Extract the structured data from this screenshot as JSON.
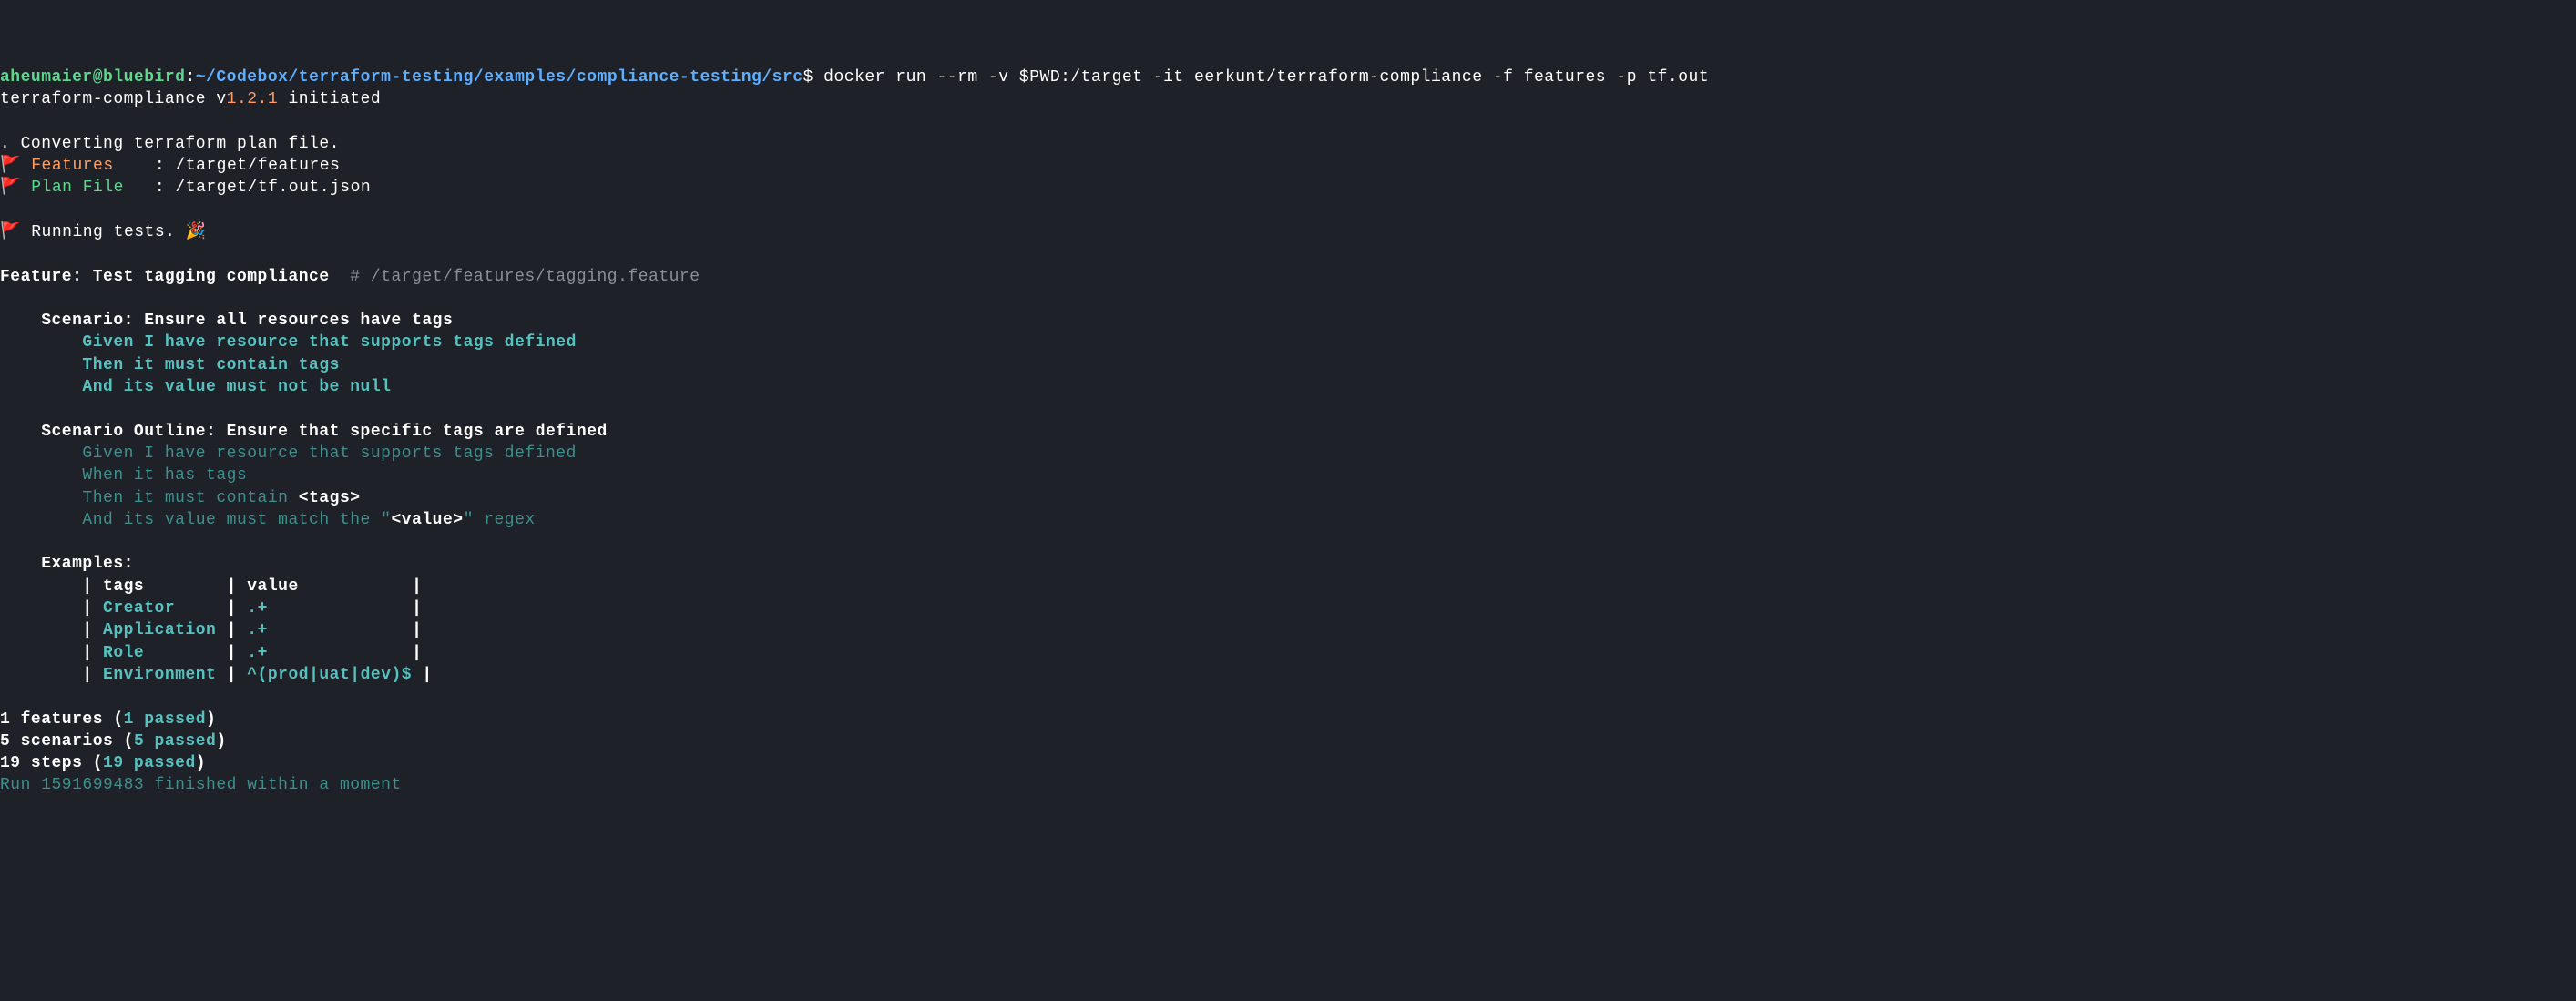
{
  "prompt": {
    "user": "aheumaier@bluebird",
    "sep": ":",
    "path": "~/Codebox/terraform-testing/examples/compliance-testing/src",
    "dollar": "$",
    "command": " docker run --rm -v $PWD:/target -it eerkunt/terraform-compliance -f features -p tf.out"
  },
  "init": {
    "prefix": "terraform-compliance v",
    "version": "1.2.1",
    "suffix": " initiated"
  },
  "converting": ". Converting terraform plan file.",
  "flag_glyph": "🚩",
  "features_label": "Features    ",
  "features_sep": ": ",
  "features_path": "/target/features",
  "plan_label": "Plan File   ",
  "plan_sep": ": ",
  "plan_path": "/target/tf.out.json",
  "running": "Running tests.",
  "confetti": "🎉",
  "feature_label": "Feature: Test tagging compliance  ",
  "feature_comment": "# /target/features/tagging.feature",
  "scenario1": {
    "title": "    Scenario: Ensure all resources have tags",
    "given": "        Given I have resource that supports tags defined",
    "then": "        Then it must contain tags",
    "and": "        And its value must not be null"
  },
  "scenario2": {
    "title": "    Scenario Outline: Ensure that specific tags are defined",
    "given": "        Given I have resource that supports tags defined",
    "when": "        When it has tags",
    "then_pre": "        Then it must contain ",
    "then_tag": "<tags>",
    "and_pre": "        And its value must match the \"",
    "and_tag": "<value>",
    "and_post": "\" regex"
  },
  "examples_label": "    Examples:",
  "table": {
    "header": "        | tags        | value           |",
    "rows": [
      {
        "pipe1": "        | ",
        "tag": "Creator    ",
        "pipe2": " | ",
        "val": ".+             ",
        "pipe3": " |"
      },
      {
        "pipe1": "        | ",
        "tag": "Application",
        "pipe2": " | ",
        "val": ".+             ",
        "pipe3": " |"
      },
      {
        "pipe1": "        | ",
        "tag": "Role       ",
        "pipe2": " | ",
        "val": ".+             ",
        "pipe3": " |"
      },
      {
        "pipe1": "        | ",
        "tag": "Environment",
        "pipe2": " | ",
        "val": "^(prod|uat|dev)$",
        "pipe3": " |"
      }
    ]
  },
  "summary": {
    "features_pre": "1 features (",
    "features_passed": "1 passed",
    "features_post": ")",
    "scenarios_pre": "5 scenarios (",
    "scenarios_passed": "5 passed",
    "scenarios_post": ")",
    "steps_pre": "19 steps (",
    "steps_passed": "19 passed",
    "steps_post": ")"
  },
  "run_line": "Run 1591699483 finished within a moment"
}
